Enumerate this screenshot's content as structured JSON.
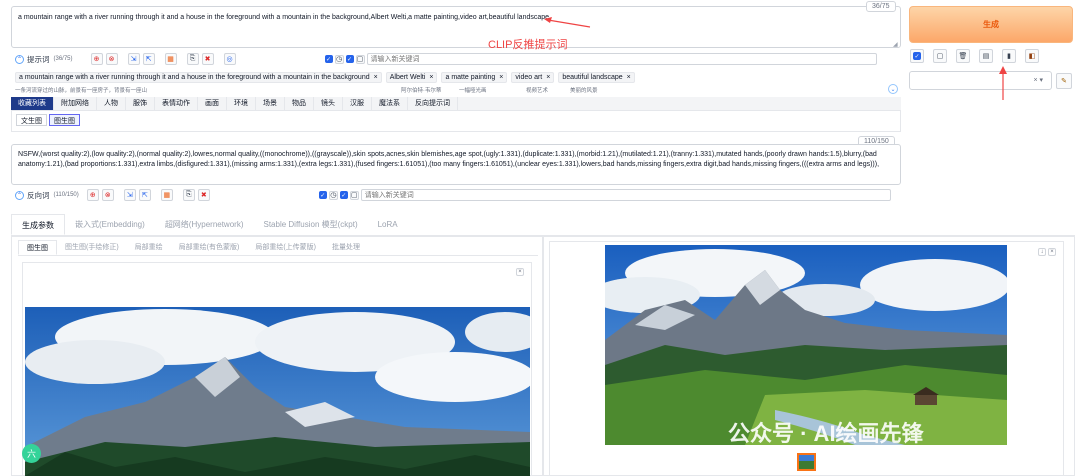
{
  "prompt": {
    "text": "a mountain range with a river running through it and a house in the foreground with a mountain in the background,Albert Welti,a matte painting,video art,beautiful landscape,",
    "counter": "36/75"
  },
  "generate_label": "生成",
  "annotation": {
    "text": "CLIP反推提示词",
    "color": "#ef4444"
  },
  "prompt_bar": {
    "label": "提示词",
    "count": "(36/75)",
    "keyword_placeholder": "请输入新关键词"
  },
  "tags": [
    {
      "text": "a mountain range with a river running through it and a house in the foreground with a mountain in the background",
      "sub": "一条河流穿过的山脉，前景有一座房子，背景有一座山"
    },
    {
      "text": "Albert Welti",
      "sub": "阿尔伯特·韦尔蒂"
    },
    {
      "text": "a matte painting",
      "sub": "一幅哑光画"
    },
    {
      "text": "video art",
      "sub": "视频艺术"
    },
    {
      "text": "beautiful landscape",
      "sub": "美丽的风景"
    }
  ],
  "category_tabs": [
    "收藏列表",
    "附加网络",
    "人物",
    "服饰",
    "表情动作",
    "画面",
    "环境",
    "场景",
    "物品",
    "镜头",
    "汉服",
    "魔法系",
    "反向提示词"
  ],
  "sub_tabs": [
    "文生图",
    "图生图"
  ],
  "negative": {
    "text": "NSFW,(worst quality:2),(low quality:2),(normal quality:2),lowres,normal quality,((monochrome)),((grayscale)),skin spots,acnes,skin blemishes,age spot,(ugly:1.331),(duplicate:1.331),(morbid:1.21),(mutilated:1.21),(tranny:1.331),mutated hands,(poorly drawn hands:1.5),blurry,(bad anatomy:1.21),(bad proportions:1.331),extra limbs,(disfigured:1.331),(missing arms:1.331),(extra legs:1.331),(fused fingers:1.61051),(too many fingers:1.61051),(unclear eyes:1.331),lowers,bad hands,missing fingers,extra digit,bad hands,missing fingers,(((extra arms and legs))),",
    "counter": "110/150",
    "label": "反向词",
    "count": "(110/150)",
    "keyword_placeholder": "请输入新关键词"
  },
  "main_tabs": [
    "生成参数",
    "嵌入式(Embedding)",
    "超网络(Hypernetwork)",
    "Stable Diffusion 模型(ckpt)",
    "LoRA"
  ],
  "img_tabs": [
    "图生图",
    "图生图(手绘修正)",
    "局部重绘",
    "局部重绘(有色蒙版)",
    "局部重绘(上传蒙版)",
    "批量处理"
  ],
  "watermark": "公众号 · AI绘画先锋",
  "badge": "六",
  "icons": {
    "close": "×",
    "check": "✓",
    "pencil": "✎",
    "arrow": "▾"
  }
}
